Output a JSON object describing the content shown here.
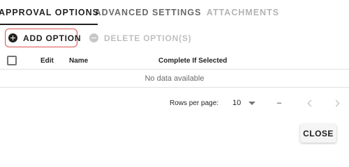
{
  "tabs": [
    {
      "label": "APPROVAL OPTIONS",
      "state": "active"
    },
    {
      "label": "ADVANCED SETTINGS",
      "state": "inactive"
    },
    {
      "label": "ATTACHMENTS",
      "state": "disabled"
    }
  ],
  "toolbar": {
    "add_label": "ADD OPTION",
    "delete_label": "DELETE OPTION(S)",
    "add_icon": "plus-circle-icon",
    "delete_icon": "minus-circle-icon",
    "highlight_color": "#d9534f"
  },
  "table": {
    "columns": [
      "Edit",
      "Name",
      "Complete If Selected"
    ],
    "empty_text": "No data available"
  },
  "pagination": {
    "rows_per_page_label": "Rows per page:",
    "rows_per_page_value": "10",
    "range_text": "–"
  },
  "dialog": {
    "close_label": "CLOSE"
  }
}
